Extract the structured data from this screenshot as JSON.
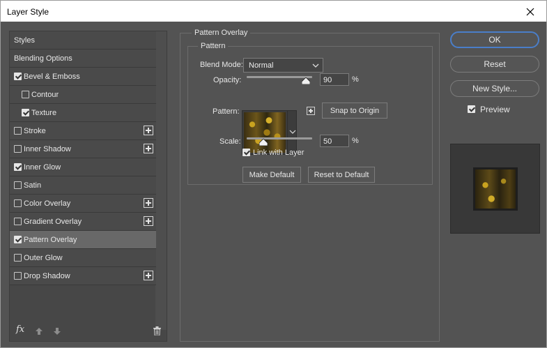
{
  "window": {
    "title": "Layer Style"
  },
  "sidebar": {
    "items": [
      {
        "label": "Styles",
        "checkbox": false,
        "checked": false,
        "indent": false,
        "plus": false,
        "selected": false
      },
      {
        "label": "Blending Options",
        "checkbox": false,
        "checked": false,
        "indent": false,
        "plus": false,
        "selected": false
      },
      {
        "label": "Bevel & Emboss",
        "checkbox": true,
        "checked": true,
        "indent": false,
        "plus": false,
        "selected": false
      },
      {
        "label": "Contour",
        "checkbox": true,
        "checked": false,
        "indent": true,
        "plus": false,
        "selected": false
      },
      {
        "label": "Texture",
        "checkbox": true,
        "checked": true,
        "indent": true,
        "plus": false,
        "selected": false
      },
      {
        "label": "Stroke",
        "checkbox": true,
        "checked": false,
        "indent": false,
        "plus": true,
        "selected": false
      },
      {
        "label": "Inner Shadow",
        "checkbox": true,
        "checked": false,
        "indent": false,
        "plus": true,
        "selected": false
      },
      {
        "label": "Inner Glow",
        "checkbox": true,
        "checked": true,
        "indent": false,
        "plus": false,
        "selected": false
      },
      {
        "label": "Satin",
        "checkbox": true,
        "checked": false,
        "indent": false,
        "plus": false,
        "selected": false
      },
      {
        "label": "Color Overlay",
        "checkbox": true,
        "checked": false,
        "indent": false,
        "plus": true,
        "selected": false
      },
      {
        "label": "Gradient Overlay",
        "checkbox": true,
        "checked": false,
        "indent": false,
        "plus": true,
        "selected": false
      },
      {
        "label": "Pattern Overlay",
        "checkbox": true,
        "checked": true,
        "indent": false,
        "plus": false,
        "selected": true
      },
      {
        "label": "Outer Glow",
        "checkbox": true,
        "checked": false,
        "indent": false,
        "plus": false,
        "selected": false
      },
      {
        "label": "Drop Shadow",
        "checkbox": true,
        "checked": false,
        "indent": false,
        "plus": true,
        "selected": false
      }
    ],
    "footer": {
      "fx_label": "fx"
    }
  },
  "panel": {
    "group_title": "Pattern Overlay",
    "subgroup_title": "Pattern",
    "blend_mode_label": "Blend Mode:",
    "blend_mode_value": "Normal",
    "opacity_label": "Opacity:",
    "opacity_value": "90",
    "opacity_fraction": 0.9,
    "percent_sign": "%",
    "pattern_label": "Pattern:",
    "snap_to_origin": "Snap to Origin",
    "scale_label": "Scale:",
    "scale_value": "50",
    "scale_fraction": 0.25,
    "link_with_layer": "Link with Layer",
    "make_default": "Make Default",
    "reset_to_default": "Reset to Default"
  },
  "actions": {
    "ok": "OK",
    "reset": "Reset",
    "new_style": "New Style...",
    "preview": "Preview"
  },
  "colors": {
    "accent": "#4a7ec9",
    "background": "#535353"
  }
}
